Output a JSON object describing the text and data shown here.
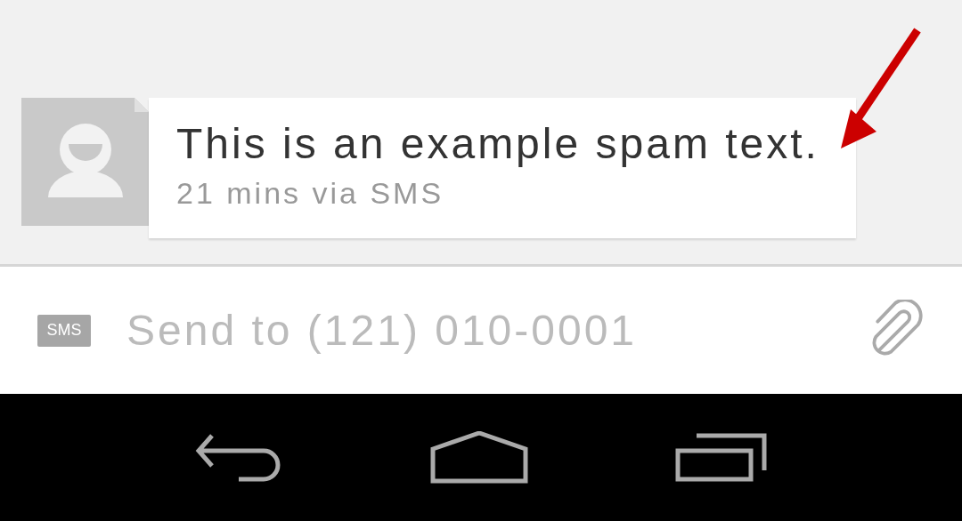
{
  "message": {
    "text": "This is an example spam text.",
    "meta": "21 mins via SMS"
  },
  "compose": {
    "badge": "SMS",
    "placeholder": "Send to (121) 010-0001"
  }
}
